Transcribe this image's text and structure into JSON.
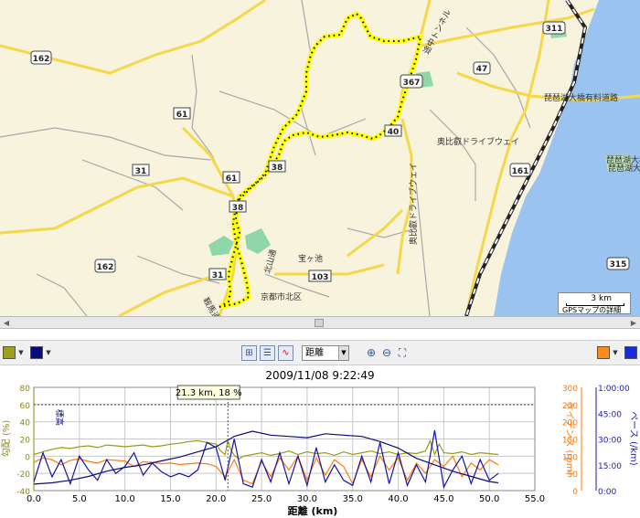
{
  "map": {
    "shields": {
      "r162a": "162",
      "r162b": "162",
      "r61a": "61",
      "r61b": "61",
      "r31a": "31",
      "r31b": "31",
      "r38a": "38",
      "r38b": "38",
      "r40": "40",
      "r367": "367",
      "r47": "47",
      "r311": "311",
      "r161": "161",
      "r315": "315",
      "r103": "103"
    },
    "labels": {
      "highway": "琵琶湖大橋有料道路",
      "drive_east": "奥比叡ドライブウェイ",
      "drive_south": "奥比叡ドライブウェイ",
      "tunnel": "途中トンネル",
      "kita_ward": "京都市北区",
      "kitayama": "北山通",
      "takaragaike": "宝ヶ池",
      "kyoto_dori": "鞍馬通",
      "lake_label1": "琵琶湖大橋",
      "lake_label2": "琵琶湖大橋"
    },
    "scale": {
      "distance": "3 km",
      "caption": "GPSマップの詳細"
    }
  },
  "toolbar": {
    "left_color1": "#a0a020",
    "left_color2": "#0a0a7a",
    "right_color1": "#ff8a1a",
    "right_color2": "#1a2ad8",
    "mode_select_value": "距離"
  },
  "chart_data": {
    "type": "line",
    "title": "2009/11/08 9:22:49",
    "xlabel": "距離 (km)",
    "x_ticks": [
      "0.0",
      "5.0",
      "10.0",
      "15.0",
      "20.0",
      "25.0",
      "30.0",
      "35.0",
      "40.0",
      "45.0",
      "50.0",
      "55.0"
    ],
    "xlim": [
      0,
      55
    ],
    "cursor": {
      "x": 21.3,
      "label": "21.3 km, 18 %"
    },
    "left_axes": [
      {
        "ylabel": "勾配 (%)",
        "ylim": [
          -40,
          80
        ],
        "ticks": [
          "80",
          "60",
          "40",
          "20",
          "0",
          "-20",
          "-40"
        ],
        "color": "#8a8a10"
      },
      {
        "ylabel": "標高",
        "ylim": [
          0,
          800
        ],
        "ticks": [],
        "color": "#0a0a7a"
      }
    ],
    "right_axes": [
      {
        "ylabel": "ケイデンス (rpm)",
        "ylim": [
          0,
          300
        ],
        "ticks": [
          "300",
          "250",
          "200",
          "150",
          "100",
          "50",
          "0"
        ],
        "color": "#ff7700"
      },
      {
        "ylabel": "ペース (/km)",
        "ylim": [
          0,
          60
        ],
        "ticks": [
          "1:00:00",
          "45:00",
          "30:00",
          "15:00",
          "0:00"
        ],
        "color": "#1a1ab0"
      }
    ],
    "series": [
      {
        "name": "勾配",
        "color": "#9a9a18",
        "x": [
          0,
          1,
          2,
          3,
          4,
          5,
          6,
          7,
          8,
          9,
          10,
          11,
          12,
          13,
          14,
          15,
          16,
          17,
          18,
          19,
          20,
          20.5,
          21,
          21.3,
          21.6,
          22,
          22.5,
          23,
          24,
          25,
          26,
          27,
          28,
          29,
          30,
          31,
          32,
          33,
          34,
          35,
          36,
          37,
          38,
          39,
          40,
          41,
          42,
          43,
          43.5,
          44,
          44.5,
          45,
          46,
          47,
          48,
          49,
          50,
          51
        ],
        "values": [
          2,
          5,
          8,
          10,
          9,
          11,
          12,
          10,
          13,
          12,
          11,
          12,
          13,
          11,
          12,
          14,
          15,
          17,
          18,
          16,
          14,
          6,
          2,
          18,
          8,
          1,
          -3,
          0,
          2,
          4,
          1,
          3,
          6,
          2,
          5,
          3,
          4,
          1,
          5,
          2,
          4,
          6,
          3,
          5,
          2,
          4,
          3,
          6,
          18,
          2,
          14,
          4,
          3,
          5,
          2,
          4,
          3,
          2
        ]
      },
      {
        "name": "ケイデンス",
        "color": "#ff7a10",
        "x": [
          0,
          1,
          2,
          3,
          4,
          5,
          6,
          7,
          8,
          9,
          10,
          11,
          12,
          13,
          14,
          15,
          16,
          17,
          18,
          19,
          20,
          21,
          22,
          23,
          24,
          25,
          26,
          27,
          28,
          29,
          30,
          31,
          32,
          33,
          34,
          35,
          36,
          37,
          38,
          39,
          40,
          41,
          42,
          43,
          44,
          45,
          46,
          47,
          48,
          49,
          50,
          51
        ],
        "values": [
          82,
          95,
          90,
          75,
          88,
          92,
          85,
          80,
          90,
          88,
          86,
          70,
          84,
          82,
          78,
          80,
          76,
          78,
          80,
          78,
          70,
          40,
          90,
          30,
          20,
          85,
          40,
          95,
          60,
          100,
          30,
          95,
          45,
          90,
          70,
          20,
          90,
          40,
          100,
          60,
          95,
          30,
          80,
          50,
          90,
          70,
          100,
          40,
          80,
          60,
          90,
          75
        ]
      },
      {
        "name": "ペース",
        "color": "#1414a0",
        "x": [
          0,
          1,
          2,
          3,
          4,
          5,
          6,
          7,
          8,
          9,
          10,
          11,
          12,
          13,
          14,
          15,
          16,
          17,
          18,
          19,
          20,
          21,
          22,
          23,
          24,
          25,
          26,
          27,
          28,
          29,
          30,
          31,
          32,
          33,
          34,
          35,
          36,
          37,
          38,
          39,
          40,
          41,
          42,
          43,
          44,
          45,
          46,
          47,
          48,
          49,
          50,
          51
        ],
        "values": [
          5,
          22,
          8,
          18,
          4,
          20,
          12,
          6,
          18,
          10,
          14,
          22,
          9,
          16,
          11,
          8,
          10,
          8,
          12,
          28,
          25,
          6,
          30,
          4,
          2,
          18,
          5,
          22,
          4,
          20,
          3,
          25,
          5,
          15,
          6,
          3,
          20,
          5,
          28,
          4,
          22,
          3,
          15,
          5,
          35,
          2,
          12,
          20,
          4,
          18,
          6,
          10
        ]
      },
      {
        "name": "標高",
        "color": "#0a0a7a",
        "x": [
          0,
          2,
          4,
          6,
          8,
          10,
          12,
          14,
          16,
          18,
          20,
          22,
          24,
          26,
          28,
          30,
          32,
          34,
          36,
          38,
          40,
          42,
          44,
          46,
          48,
          50,
          51
        ],
        "values": [
          50,
          60,
          80,
          110,
          150,
          180,
          200,
          230,
          260,
          300,
          340,
          420,
          460,
          430,
          420,
          410,
          440,
          430,
          420,
          380,
          330,
          250,
          200,
          150,
          110,
          70,
          60
        ]
      }
    ]
  }
}
